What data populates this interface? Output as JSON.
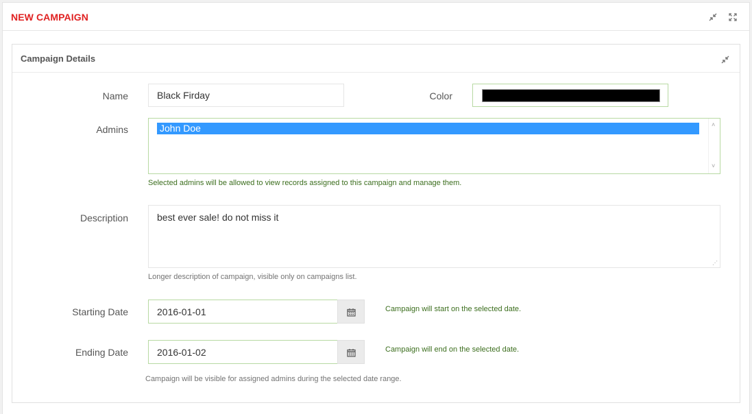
{
  "panel": {
    "title": "NEW CAMPAIGN"
  },
  "section": {
    "title": "Campaign Details"
  },
  "form": {
    "name_label": "Name",
    "name_value": "Black Firday",
    "color_label": "Color",
    "color_value": "#000000",
    "admins_label": "Admins",
    "admins_options": [
      "John Doe"
    ],
    "admins_help": "Selected admins will be allowed to view records assigned to this campaign and manage them.",
    "description_label": "Description",
    "description_value": "best ever sale! do not miss it",
    "description_help": "Longer description of campaign, visible only on campaigns list.",
    "start_label": "Starting Date",
    "start_value": "2016-01-01",
    "start_help": "Campaign will start on the selected date.",
    "end_label": "Ending Date",
    "end_value": "2016-01-02",
    "end_help": "Campaign will end on the selected date.",
    "range_help": "Campaign will be visible for assigned admins during the selected date range."
  },
  "colors": {
    "title_red": "#e02222",
    "valid_green": "#b7d9a2",
    "help_green": "#3c6e1e",
    "selection_blue": "#3399ff"
  },
  "icons": {
    "collapse": "compress-arrows-icon",
    "fullscreen": "expand-arrows-icon",
    "calendar": "calendar-icon"
  }
}
